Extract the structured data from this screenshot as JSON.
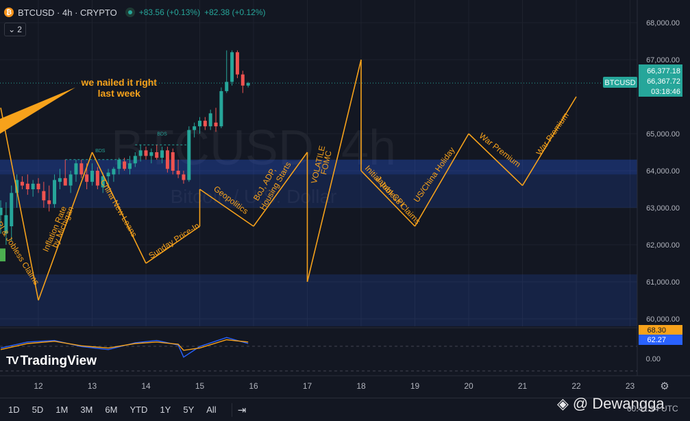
{
  "header": {
    "symbol": "BTCUSD",
    "interval": "4h",
    "exchange": "CRYPTO",
    "title": "BTCUSD · 4h · CRYPTO",
    "coin_glyph": "₿",
    "change1": "+83.56 (+0.13%)",
    "change2": "+82.38 (+0.12%)",
    "indicators_count": "2"
  },
  "colors": {
    "background": "#131722",
    "up": "#26a69a",
    "down": "#ef5350",
    "annotation": "#f7a21b",
    "zone": "#2962ff",
    "price_label": "#26a69a"
  },
  "watermark_bg": {
    "line1": "BTCUSD, 4h",
    "line2": "Bitcoin / U.S. Dollar"
  },
  "price_axis": {
    "ticks": [
      {
        "price": 68000,
        "label": "68,000.00"
      },
      {
        "price": 67000,
        "label": "67,000.00"
      },
      {
        "price": 65000,
        "label": "65,000.00"
      },
      {
        "price": 64000,
        "label": "64,000.00"
      },
      {
        "price": 63000,
        "label": "63,000.00"
      },
      {
        "price": 62000,
        "label": "62,000.00"
      },
      {
        "price": 61000,
        "label": "61,000.00"
      },
      {
        "price": 60000,
        "label": "60,000.00"
      }
    ],
    "labels": [
      {
        "price": 66377.18,
        "text": "66,377.18"
      },
      {
        "price": 66367.72,
        "text": "66,367.72"
      },
      {
        "price": 66230,
        "text": "03:18:46"
      }
    ],
    "symbol_tag": "BTCUSD",
    "current_price": 66367.72
  },
  "indicator_axis": {
    "labels": [
      {
        "value": 68.3,
        "text": "68.30"
      },
      {
        "value": 62.27,
        "text": "62.27"
      }
    ],
    "zero": "0.00"
  },
  "time_axis": {
    "labels": [
      {
        "day": 12,
        "text": "12"
      },
      {
        "day": 13,
        "text": "13"
      },
      {
        "day": 14,
        "text": "14"
      },
      {
        "day": 15,
        "text": "15"
      },
      {
        "day": 16,
        "text": "16"
      },
      {
        "day": 17,
        "text": "17"
      },
      {
        "day": 18,
        "text": "18"
      },
      {
        "day": 19,
        "text": "19"
      },
      {
        "day": 20,
        "text": "20"
      },
      {
        "day": 21,
        "text": "21"
      },
      {
        "day": 22,
        "text": "22"
      },
      {
        "day": 23,
        "text": "23"
      }
    ]
  },
  "zones": [
    {
      "from": 63900,
      "to": 64300
    },
    {
      "from": 63700,
      "to": 64300
    },
    {
      "from": 63000,
      "to": 63700
    },
    {
      "from": 59800,
      "to": 61200
    }
  ],
  "chart_data": {
    "type": "candlestick",
    "y_range": [
      59800,
      68500
    ],
    "x_range_days": [
      11.3,
      23.2
    ],
    "candles": [
      {
        "t": 11.3,
        "o": 62800,
        "h": 63200,
        "l": 62300,
        "c": 63000
      },
      {
        "t": 11.4,
        "o": 62300,
        "h": 63150,
        "l": 62000,
        "c": 62800
      },
      {
        "t": 11.5,
        "o": 62500,
        "h": 63600,
        "l": 62100,
        "c": 63400
      },
      {
        "t": 11.6,
        "o": 63400,
        "h": 63900,
        "l": 63000,
        "c": 63750
      },
      {
        "t": 11.7,
        "o": 63700,
        "h": 63850,
        "l": 63500,
        "c": 63600
      },
      {
        "t": 11.8,
        "o": 63650,
        "h": 63900,
        "l": 63350,
        "c": 63500
      },
      {
        "t": 11.9,
        "o": 63500,
        "h": 63750,
        "l": 63300,
        "c": 63650
      },
      {
        "t": 12.0,
        "o": 63650,
        "h": 63800,
        "l": 63400,
        "c": 63500
      },
      {
        "t": 12.1,
        "o": 63450,
        "h": 63700,
        "l": 63000,
        "c": 63200
      },
      {
        "t": 12.2,
        "o": 63200,
        "h": 63600,
        "l": 62900,
        "c": 63100
      },
      {
        "t": 12.3,
        "o": 63100,
        "h": 63900,
        "l": 63000,
        "c": 63750
      },
      {
        "t": 12.4,
        "o": 63700,
        "h": 64050,
        "l": 63500,
        "c": 63800
      },
      {
        "t": 12.5,
        "o": 63800,
        "h": 64300,
        "l": 63600,
        "c": 63600
      },
      {
        "t": 12.6,
        "o": 63600,
        "h": 64000,
        "l": 63400,
        "c": 63900
      },
      {
        "t": 12.7,
        "o": 63900,
        "h": 64300,
        "l": 63700,
        "c": 64200
      },
      {
        "t": 12.8,
        "o": 64200,
        "h": 64300,
        "l": 63800,
        "c": 63900
      },
      {
        "t": 12.9,
        "o": 63900,
        "h": 64200,
        "l": 63500,
        "c": 63700
      },
      {
        "t": 13.0,
        "o": 63700,
        "h": 64200,
        "l": 63600,
        "c": 64000
      },
      {
        "t": 13.1,
        "o": 64000,
        "h": 64100,
        "l": 63500,
        "c": 63600
      },
      {
        "t": 13.2,
        "o": 63550,
        "h": 63950,
        "l": 63400,
        "c": 63850
      },
      {
        "t": 13.3,
        "o": 63850,
        "h": 64050,
        "l": 63600,
        "c": 63950
      },
      {
        "t": 13.4,
        "o": 63900,
        "h": 64100,
        "l": 63700,
        "c": 64050
      },
      {
        "t": 13.5,
        "o": 64050,
        "h": 64350,
        "l": 63900,
        "c": 64300
      },
      {
        "t": 13.6,
        "o": 64250,
        "h": 64350,
        "l": 64000,
        "c": 64050
      },
      {
        "t": 13.7,
        "o": 64050,
        "h": 64400,
        "l": 63900,
        "c": 64200
      },
      {
        "t": 13.8,
        "o": 64200,
        "h": 64500,
        "l": 64100,
        "c": 64400
      },
      {
        "t": 13.9,
        "o": 64400,
        "h": 64700,
        "l": 64250,
        "c": 64550
      },
      {
        "t": 14.0,
        "o": 64550,
        "h": 64650,
        "l": 64300,
        "c": 64400
      },
      {
        "t": 14.1,
        "o": 64400,
        "h": 64600,
        "l": 64200,
        "c": 64500
      },
      {
        "t": 14.2,
        "o": 64500,
        "h": 64700,
        "l": 64300,
        "c": 64350
      },
      {
        "t": 14.3,
        "o": 64350,
        "h": 64650,
        "l": 64200,
        "c": 64550
      },
      {
        "t": 14.4,
        "o": 64550,
        "h": 64650,
        "l": 63950,
        "c": 64050
      },
      {
        "t": 14.5,
        "o": 64500,
        "h": 64600,
        "l": 63900,
        "c": 64000
      },
      {
        "t": 14.6,
        "o": 64000,
        "h": 64300,
        "l": 63800,
        "c": 63900
      },
      {
        "t": 14.7,
        "o": 63900,
        "h": 64000,
        "l": 63650,
        "c": 63750
      },
      {
        "t": 14.8,
        "o": 63750,
        "h": 65200,
        "l": 63700,
        "c": 65100
      },
      {
        "t": 14.9,
        "o": 65100,
        "h": 65300,
        "l": 64900,
        "c": 65200
      },
      {
        "t": 15.0,
        "o": 65200,
        "h": 65450,
        "l": 65000,
        "c": 65350
      },
      {
        "t": 15.1,
        "o": 65350,
        "h": 65450,
        "l": 65100,
        "c": 65200
      },
      {
        "t": 15.2,
        "o": 65200,
        "h": 65650,
        "l": 65100,
        "c": 65550
      },
      {
        "t": 15.3,
        "o": 65300,
        "h": 65700,
        "l": 65050,
        "c": 65200
      },
      {
        "t": 15.4,
        "o": 65200,
        "h": 66250,
        "l": 65150,
        "c": 66150
      },
      {
        "t": 15.5,
        "o": 66150,
        "h": 67250,
        "l": 66100,
        "c": 66400
      },
      {
        "t": 15.6,
        "o": 66400,
        "h": 67250,
        "l": 66300,
        "c": 67200
      },
      {
        "t": 15.7,
        "o": 67200,
        "h": 67250,
        "l": 66500,
        "c": 66600
      },
      {
        "t": 15.8,
        "o": 66600,
        "h": 66700,
        "l": 66100,
        "c": 66300
      },
      {
        "t": 15.9,
        "o": 66300,
        "h": 66400,
        "l": 66250,
        "c": 66367.72
      }
    ],
    "bds_labels": [
      {
        "t": 13.15,
        "price": 64500,
        "text": "BDS"
      },
      {
        "t": 14.3,
        "price": 64950,
        "text": "BDS"
      }
    ],
    "projection_path": [
      [
        11.3,
        65700
      ],
      [
        12.0,
        60500
      ],
      [
        13.0,
        64500
      ],
      [
        14.0,
        61500
      ],
      [
        15.0,
        62500
      ],
      [
        15.0,
        63500
      ],
      [
        16.0,
        62500
      ],
      [
        17.0,
        64500
      ],
      [
        17.0,
        61000
      ],
      [
        18.0,
        67000
      ],
      [
        18.0,
        64000
      ],
      [
        19.0,
        62500
      ],
      [
        20.0,
        65000
      ],
      [
        21.0,
        63600
      ],
      [
        22.0,
        66000
      ]
    ],
    "annotations": [
      {
        "text": "we nailed it right",
        "t": 13.5,
        "price": 66300,
        "rot": 0,
        "align": "middle",
        "size": 14,
        "bold": true
      },
      {
        "text": "last week",
        "t": 13.5,
        "price": 66000,
        "rot": 0,
        "align": "middle",
        "size": 14,
        "bold": true
      },
      {
        "text": "Inflation Rate",
        "t": 12.35,
        "price": 62400,
        "rot": -67,
        "align": "middle",
        "size": 12,
        "bold": false
      },
      {
        "text": "by Michigan",
        "t": 12.5,
        "price": 62450,
        "rot": -67,
        "align": "middle",
        "size": 12,
        "bold": false
      },
      {
        "text": "PPI & Jobless Claims",
        "t": 11.55,
        "price": 61800,
        "rot": 58,
        "align": "middle",
        "size": 12,
        "bold": false
      },
      {
        "text": "China New Loans",
        "t": 13.45,
        "price": 62950,
        "rot": 60,
        "align": "middle",
        "size": 12,
        "bold": false
      },
      {
        "text": "Sunday Price-In",
        "t": 14.55,
        "price": 62050,
        "rot": -33,
        "align": "middle",
        "size": 12,
        "bold": false
      },
      {
        "text": "Geopolitics",
        "t": 15.55,
        "price": 63150,
        "rot": 37,
        "align": "middle",
        "size": 12,
        "bold": false
      },
      {
        "text": "BoJ, ADP,",
        "t": 16.25,
        "price": 63600,
        "rot": -60,
        "align": "middle",
        "size": 12,
        "bold": false
      },
      {
        "text": "Housing Starts",
        "t": 16.45,
        "price": 63550,
        "rot": -60,
        "align": "middle",
        "size": 12,
        "bold": false
      },
      {
        "text": "VOLATILE",
        "t": 17.25,
        "price": 64150,
        "rot": -77,
        "align": "middle",
        "size": 12,
        "bold": false
      },
      {
        "text": "FOMC",
        "t": 17.4,
        "price": 64200,
        "rot": -77,
        "align": "middle",
        "size": 12,
        "bold": false
      },
      {
        "text": "Initial Jobless Claims",
        "t": 18.55,
        "price": 63300,
        "rot": 47,
        "align": "middle",
        "size": 12,
        "bold": false
      },
      {
        "text": "Japan CPI",
        "t": 18.5,
        "price": 63400,
        "rot": 47,
        "align": "middle",
        "size": 12,
        "bold": false
      },
      {
        "text": "US/China Holiday",
        "t": 19.4,
        "price": 63850,
        "rot": -55,
        "align": "middle",
        "size": 12,
        "bold": false
      },
      {
        "text": "War Premium",
        "t": 20.55,
        "price": 64500,
        "rot": 38,
        "align": "middle",
        "size": 12,
        "bold": false
      },
      {
        "text": "War Premium",
        "t": 21.6,
        "price": 64950,
        "rot": -55,
        "align": "middle",
        "size": 12,
        "bold": false
      }
    ]
  },
  "indicator": {
    "series": [
      {
        "name": "",
        "color": "#2962ff",
        "values": [
          [
            11.3,
            0.2
          ],
          [
            11.8,
            0.6
          ],
          [
            12.3,
            0.7
          ],
          [
            12.8,
            0.3
          ],
          [
            13.3,
            0.1
          ],
          [
            13.8,
            0.55
          ],
          [
            14.2,
            0.7
          ],
          [
            14.6,
            0.4
          ],
          [
            14.7,
            -0.4
          ],
          [
            15.0,
            0.3
          ],
          [
            15.5,
            0.9
          ],
          [
            15.9,
            0.5
          ]
        ]
      },
      {
        "name": "",
        "color": "#f7a21b",
        "values": [
          [
            11.3,
            0.1
          ],
          [
            11.8,
            0.5
          ],
          [
            12.3,
            0.65
          ],
          [
            12.8,
            0.35
          ],
          [
            13.3,
            0.2
          ],
          [
            13.8,
            0.5
          ],
          [
            14.2,
            0.6
          ],
          [
            14.6,
            0.45
          ],
          [
            14.7,
            0.05
          ],
          [
            15.0,
            0.2
          ],
          [
            15.5,
            0.75
          ],
          [
            15.9,
            0.6
          ]
        ]
      }
    ]
  },
  "bottombar": {
    "ranges": [
      "1D",
      "5D",
      "1M",
      "3M",
      "6M",
      "YTD",
      "1Y",
      "5Y",
      "All"
    ],
    "clock": "00:41:14 UTC"
  },
  "tv_logo": {
    "mark": "TV",
    "text": "TradingView"
  },
  "author_watermark": "@ Dewangga"
}
